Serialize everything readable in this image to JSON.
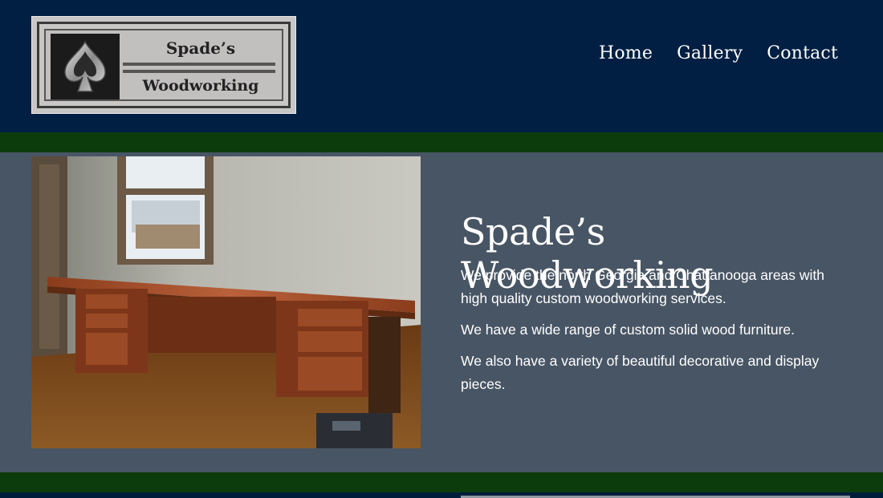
{
  "logo": {
    "line1": "Spade’s",
    "line2": "Woodworking",
    "icon": "spade-icon"
  },
  "nav": {
    "items": [
      {
        "label": "Home"
      },
      {
        "label": "Gallery"
      },
      {
        "label": "Contact"
      }
    ]
  },
  "hero": {
    "title": "Spade’s Woodworking",
    "paragraphs": [
      "We provide the north Georgia and Chattanooga areas with high quality custom woodworking services.",
      "We have a wide range of custom solid wood furniture.",
      "We also have a variety of beautiful decorative and display pieces."
    ]
  },
  "colors": {
    "header_bg": "#001f42",
    "accent_band": "#0c3b0c",
    "content_bg": "#485564",
    "text": "#ffffff"
  }
}
